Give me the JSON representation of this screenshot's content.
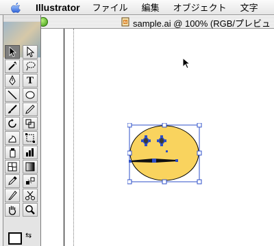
{
  "menubar": {
    "app_name": "Illustrator",
    "items": [
      "ファイル",
      "編集",
      "オブジェクト",
      "文字"
    ]
  },
  "document": {
    "title": "sample.ai @ 100% (RGB/プレビュ"
  },
  "colors": {
    "face_fill": "#F9D35E",
    "selection": "#2E4FC8"
  },
  "toolbox": {
    "tools": [
      "selection-tool-icon",
      "direct-selection-tool-icon",
      "magic-wand-tool-icon",
      "lasso-tool-icon",
      "pen-tool-icon",
      "type-tool-icon",
      "line-segment-tool-icon",
      "ellipse-tool-icon",
      "paintbrush-tool-icon",
      "pencil-tool-icon",
      "rotate-tool-icon",
      "scale-tool-icon",
      "warp-tool-icon",
      "free-transform-tool-icon",
      "symbol-sprayer-tool-icon",
      "column-graph-tool-icon",
      "mesh-tool-icon",
      "gradient-tool-icon",
      "eyedropper-tool-icon",
      "blend-tool-icon",
      "slice-tool-icon",
      "scissors-tool-icon",
      "hand-tool-icon",
      "zoom-tool-icon"
    ],
    "type_tool_label": "T"
  }
}
